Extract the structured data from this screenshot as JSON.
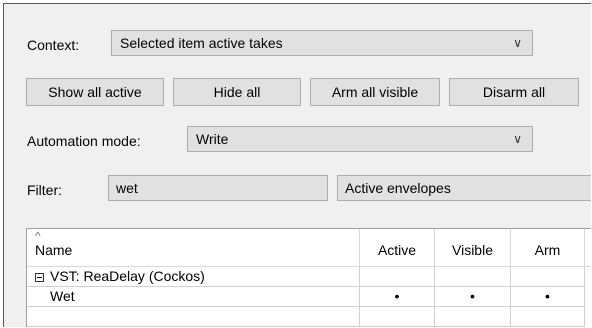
{
  "context": {
    "label": "Context:",
    "value": "Selected item active takes"
  },
  "buttons": {
    "show_all_active": "Show all active",
    "hide_all": "Hide all",
    "arm_all_visible": "Arm all visible",
    "disarm_all": "Disarm all"
  },
  "automation": {
    "label": "Automation mode:",
    "value": "Write"
  },
  "filter": {
    "label": "Filter:",
    "value": "wet",
    "scope": "Active envelopes"
  },
  "table": {
    "columns": [
      "Name",
      "Active",
      "Visible",
      "Arm"
    ],
    "group": {
      "label": "VST: ReaDelay (Cockos)"
    },
    "rows": [
      {
        "name": "Wet",
        "active": "•",
        "visible": "•",
        "arm": "•"
      }
    ]
  }
}
